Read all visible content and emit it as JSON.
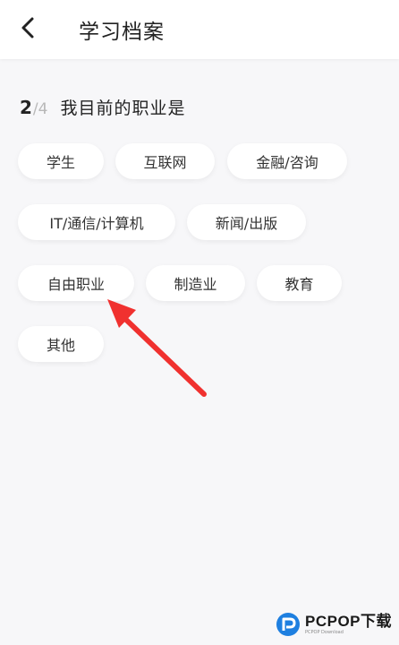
{
  "header": {
    "title": "学习档案",
    "back_icon": "chevron-left-icon"
  },
  "step": {
    "current": "2",
    "separator": "/",
    "total": "4",
    "question": "我目前的职业是"
  },
  "options": [
    "学生",
    "互联网",
    "金融/咨询",
    "IT/通信/计算机",
    "新闻/出版",
    "自由职业",
    "制造业",
    "教育",
    "其他"
  ],
  "annotation": {
    "arrow_color": "#f0312f"
  },
  "watermark": {
    "brand": "PCPOP下载",
    "sub": "PCPOP Download",
    "accent": "#1e7fe0"
  }
}
